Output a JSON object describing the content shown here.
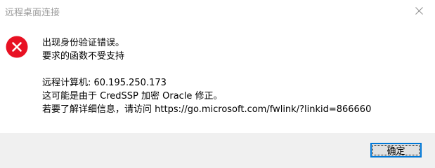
{
  "window": {
    "title": "远程桌面连接",
    "close_icon": "close-icon"
  },
  "dialog": {
    "icon": "error-icon",
    "icon_color": "#e81123",
    "lines": [
      "出现身份验证错误。",
      "要求的函数不受支持",
      "",
      "远程计算机: 60.195.250.173",
      "这可能是由于 CredSSP 加密 Oracle 修正。",
      "若要了解详细信息，请访问 https://go.microsoft.com/fwlink/?linkid=866660"
    ]
  },
  "footer": {
    "ok_label": "确定",
    "accent": "#0078d7"
  }
}
